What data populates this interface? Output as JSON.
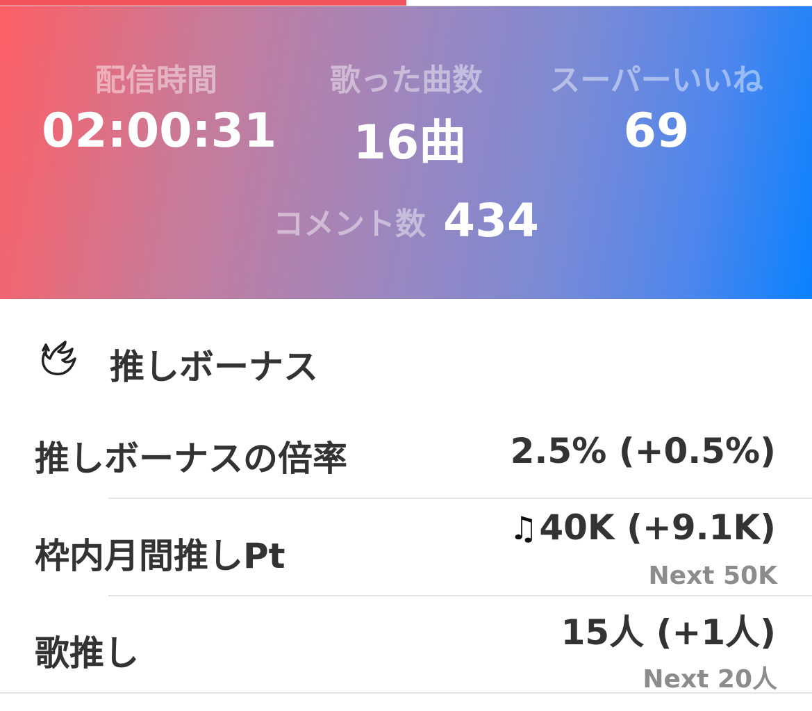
{
  "progress": {
    "fraction": 0.5,
    "fill_color": "#f0545a"
  },
  "hero": {
    "gradient_colors": [
      "#fd5f64",
      "#9f86bc",
      "#0a82ff"
    ],
    "stats": [
      {
        "label": "配信時間",
        "value": "02:00:31"
      },
      {
        "label": "歌った曲数",
        "value": "16曲"
      },
      {
        "label": "スーパーいいね",
        "value": "69"
      }
    ],
    "comments": {
      "label": "コメント数",
      "value": "434"
    }
  },
  "bonus": {
    "icon": "wing-icon",
    "title": "推しボーナス",
    "rows": [
      {
        "label": "推しボーナスの倍率",
        "value": "2.5% (+0.5%)"
      },
      {
        "label": "枠内月間推しPt",
        "icon": "music-note-icon",
        "value": "40K (+9.1K)",
        "next": "Next 50K"
      },
      {
        "label": "歌推し",
        "value": "15人 (+1人)",
        "next": "Next 20人"
      }
    ]
  }
}
